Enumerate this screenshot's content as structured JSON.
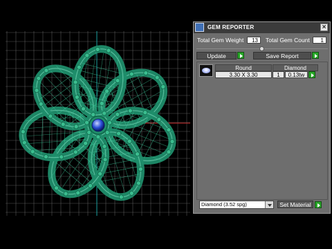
{
  "panel": {
    "title": "GEM REPORTER",
    "close_symbol": "×",
    "total_weight_label": "Total Gem Weight",
    "total_weight_value": "13",
    "total_count_label": "Total Gem Count",
    "total_count_value": "1",
    "update_label": "Update",
    "save_report_label": "Save Report",
    "gems": [
      {
        "shape_header": "Round",
        "size": "3.30 X 3.30",
        "count": "1",
        "material_header": "Diamond",
        "weight": "0.13tw"
      }
    ],
    "material_select": "Diamond    (3.52 spg)",
    "set_material_label": "Set Material"
  },
  "colors": {
    "ring_green": "#1f8d6a",
    "gem_blue": "#2b4fd8",
    "grid_line": "#7a7a7a",
    "axis_red": "#cc2b2b",
    "axis_cyan": "#1aa0a0"
  },
  "icons": {
    "app_icon": "gem-reporter-app-icon",
    "close_icon": "close-icon",
    "play_icon": "green-arrow-icon",
    "dropdown_icon": "chevron-down-icon"
  }
}
